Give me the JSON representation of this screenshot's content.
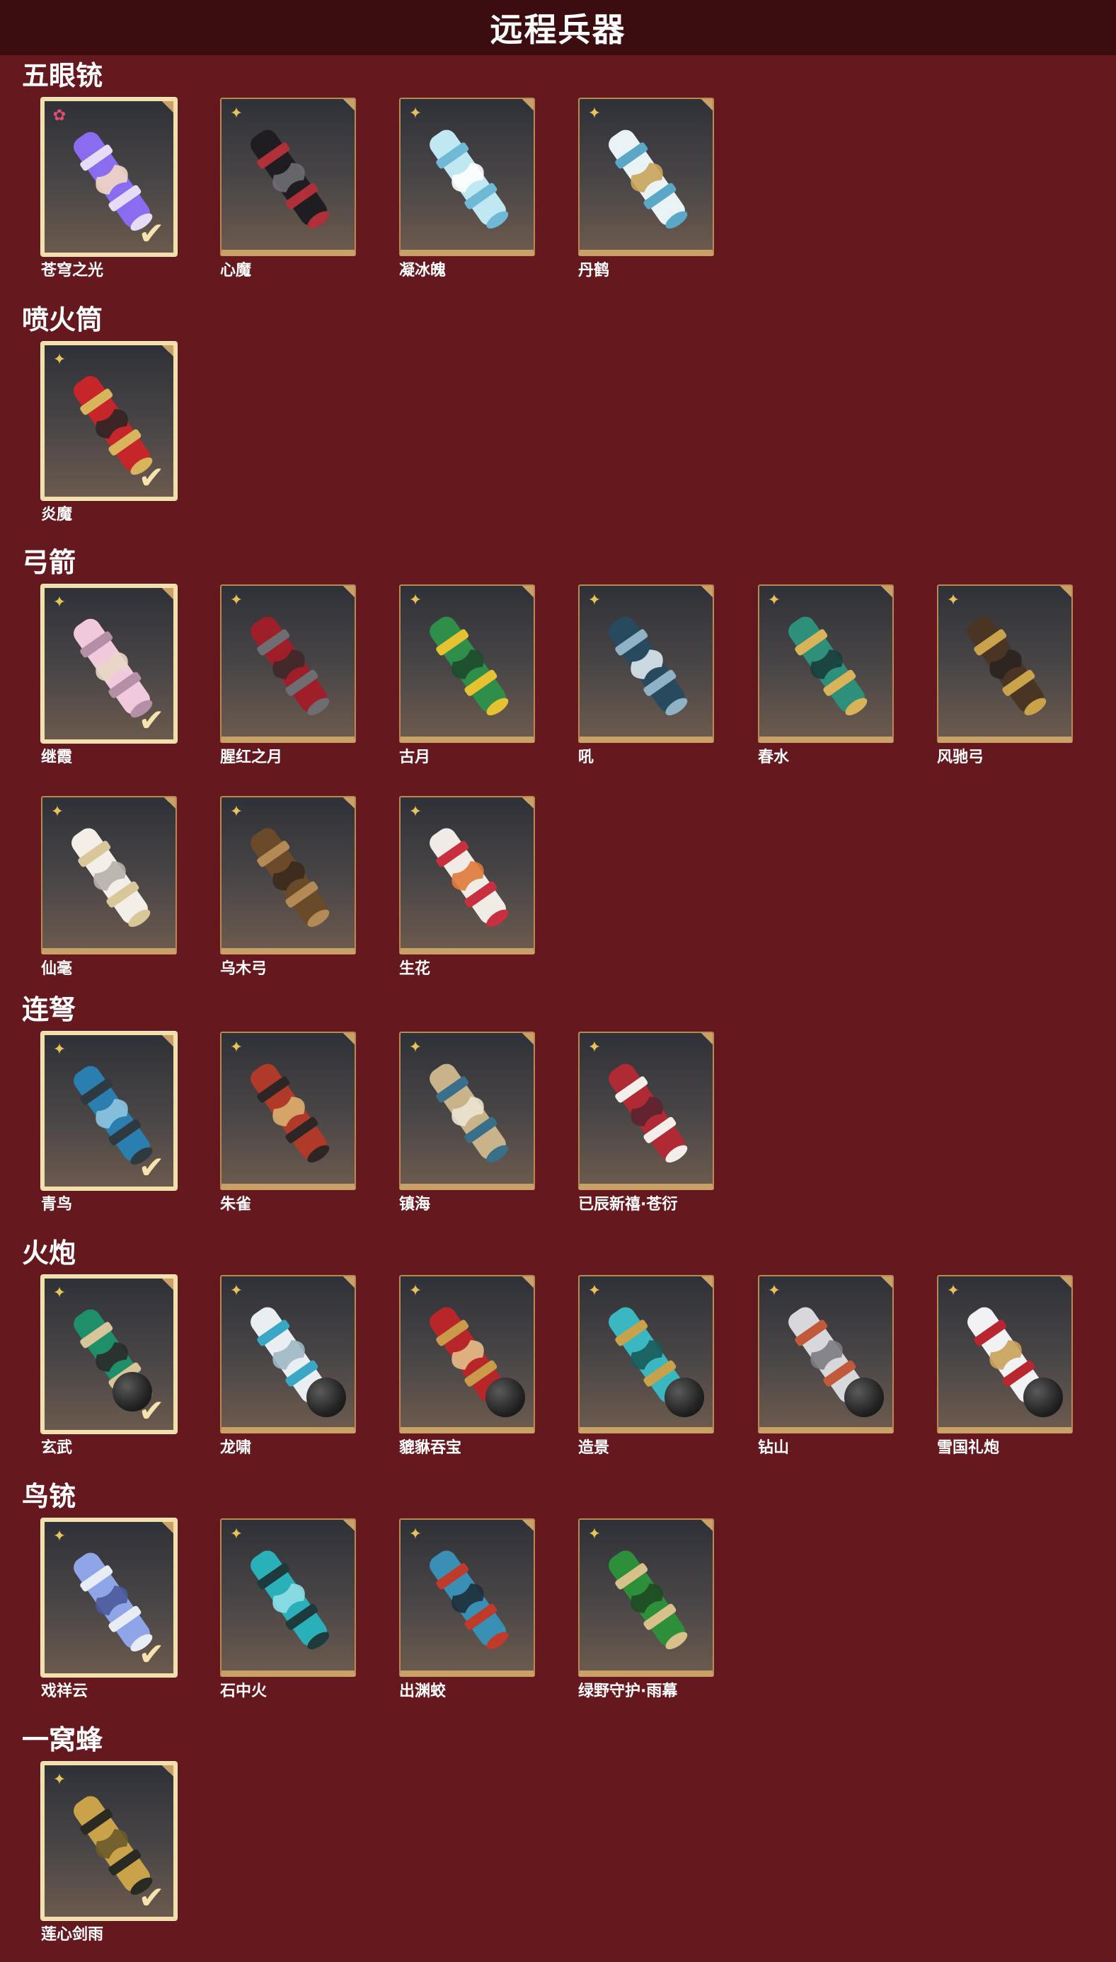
{
  "page_title": "远程兵器",
  "colors": {
    "background": "#65181e",
    "title_bar": "#3b0c10",
    "frame_gold": "#c9a068",
    "owned_frame": "#f3dfaa",
    "quality_gold": "#e8c15a",
    "quality_pink": "#e04f6b"
  },
  "sections": [
    {
      "title": "五眼铳",
      "items": [
        {
          "name": "苍穹之光",
          "owned": true,
          "quality_icon": "pink-star-icon",
          "colors": [
            "#8a6cf0",
            "#e7dcf5",
            "#f3d8c2"
          ]
        },
        {
          "name": "心魔",
          "owned": false,
          "quality_icon": "gold-star-icon",
          "colors": [
            "#1f1d22",
            "#b0303a",
            "#6e6e74"
          ]
        },
        {
          "name": "凝冰魄",
          "owned": false,
          "quality_icon": "gold-star-icon",
          "colors": [
            "#bfe8f3",
            "#6fb8d6",
            "#ffffff"
          ]
        },
        {
          "name": "丹鹤",
          "owned": false,
          "quality_icon": "gold-star-icon",
          "colors": [
            "#e9f2f5",
            "#5aa7c7",
            "#c9a45a"
          ]
        }
      ]
    },
    {
      "title": "喷火筒",
      "items": [
        {
          "name": "炎魔",
          "owned": true,
          "quality_icon": "gold-star-icon",
          "colors": [
            "#c6262a",
            "#d8b55c",
            "#2b2725"
          ]
        }
      ]
    },
    {
      "title": "弓箭",
      "items": [
        {
          "name": "继霞",
          "owned": true,
          "quality_icon": "gold-star-icon",
          "colors": [
            "#f1c9dd",
            "#b58fa6",
            "#e8d7c5"
          ]
        },
        {
          "name": "腥红之月",
          "owned": false,
          "quality_icon": "gold-star-icon",
          "colors": [
            "#9e1f2a",
            "#6e6d72",
            "#3a2a2a"
          ]
        },
        {
          "name": "古月",
          "owned": false,
          "quality_icon": "gold-star-icon",
          "colors": [
            "#2f8f4a",
            "#e4c232",
            "#1f4a2c"
          ]
        },
        {
          "name": "吼",
          "owned": false,
          "quality_icon": "gold-star-icon",
          "colors": [
            "#274a5f",
            "#8fb2c5",
            "#dfe8ee"
          ]
        },
        {
          "name": "春水",
          "owned": false,
          "quality_icon": "gold-star-icon",
          "colors": [
            "#2e8f7a",
            "#d8b35a",
            "#1a3d3a"
          ]
        },
        {
          "name": "风驰弓",
          "owned": false,
          "quality_icon": "gold-star-icon",
          "colors": [
            "#4a3525",
            "#c9a24a",
            "#2a2420"
          ]
        },
        {
          "name": "仙毫",
          "owned": false,
          "quality_icon": "gold-star-icon",
          "colors": [
            "#f3efe8",
            "#d9c79a",
            "#b6b0a8"
          ]
        },
        {
          "name": "乌木弓",
          "owned": false,
          "quality_icon": "gold-star-icon",
          "colors": [
            "#6b4a2a",
            "#b38a55",
            "#3a2a1e"
          ]
        },
        {
          "name": "生花",
          "owned": false,
          "quality_icon": "gold-star-icon",
          "colors": [
            "#f0ebe5",
            "#c83040",
            "#e07a3a"
          ]
        }
      ]
    },
    {
      "title": "连弩",
      "items": [
        {
          "name": "青鸟",
          "owned": true,
          "quality_icon": "gold-star-icon",
          "colors": [
            "#2a7fb0",
            "#2e3a40",
            "#8fc5e0"
          ]
        },
        {
          "name": "朱雀",
          "owned": false,
          "quality_icon": "gold-star-icon",
          "colors": [
            "#b03a2a",
            "#2e2624",
            "#d8b070"
          ]
        },
        {
          "name": "镇海",
          "owned": false,
          "quality_icon": "gold-star-icon",
          "colors": [
            "#c9b38a",
            "#3a6f8a",
            "#ece4d3"
          ]
        },
        {
          "name": "已辰新禧·苍衍",
          "owned": false,
          "quality_icon": "gold-star-icon",
          "colors": [
            "#b02a35",
            "#f3eeea",
            "#5a2530"
          ]
        }
      ]
    },
    {
      "title": "火炮",
      "items": [
        {
          "name": "玄武",
          "owned": true,
          "quality_icon": "gold-star-icon",
          "has_ball": true,
          "colors": [
            "#1f8f6a",
            "#d9c59a",
            "#2a2a2a"
          ]
        },
        {
          "name": "龙啸",
          "owned": false,
          "quality_icon": "gold-star-icon",
          "has_ball": true,
          "colors": [
            "#e8eef2",
            "#3aa7c5",
            "#9fb7c5"
          ]
        },
        {
          "name": "貔貅吞宝",
          "owned": false,
          "quality_icon": "gold-star-icon",
          "has_ball": true,
          "colors": [
            "#b8262a",
            "#c89a4a",
            "#e2c08a"
          ]
        },
        {
          "name": "造景",
          "owned": false,
          "quality_icon": "gold-star-icon",
          "has_ball": true,
          "colors": [
            "#3ab7c0",
            "#c8a24a",
            "#1a5a5a"
          ]
        },
        {
          "name": "钻山",
          "owned": false,
          "quality_icon": "gold-star-icon",
          "has_ball": true,
          "colors": [
            "#d8d8dc",
            "#c05a3a",
            "#7c7c82"
          ]
        },
        {
          "name": "雪国礼炮",
          "owned": false,
          "quality_icon": "gold-star-icon",
          "has_ball": true,
          "colors": [
            "#f2f2f4",
            "#b82630",
            "#c9a25a"
          ]
        }
      ]
    },
    {
      "title": "鸟铳",
      "items": [
        {
          "name": "戏祥云",
          "owned": true,
          "quality_icon": "gold-star-icon",
          "colors": [
            "#8fa5e8",
            "#e8ecf5",
            "#4a5a9a"
          ]
        },
        {
          "name": "石中火",
          "owned": false,
          "quality_icon": "gold-star-icon",
          "colors": [
            "#2ab0b8",
            "#1e3a3c",
            "#8fe0e5"
          ]
        },
        {
          "name": "出渊蛟",
          "owned": false,
          "quality_icon": "gold-star-icon",
          "colors": [
            "#3a8fb5",
            "#c03a2a",
            "#1e2e3a"
          ]
        },
        {
          "name": "绿野守护·雨幕",
          "owned": false,
          "quality_icon": "gold-star-icon",
          "colors": [
            "#2e8f3a",
            "#d8c08a",
            "#1e4a24"
          ]
        }
      ]
    },
    {
      "title": "一窝蜂",
      "items": [
        {
          "name": "莲心剑雨",
          "owned": true,
          "quality_icon": "gold-star-icon",
          "colors": [
            "#c9a24a",
            "#2a2a24",
            "#6a5a2a"
          ]
        }
      ]
    }
  ]
}
